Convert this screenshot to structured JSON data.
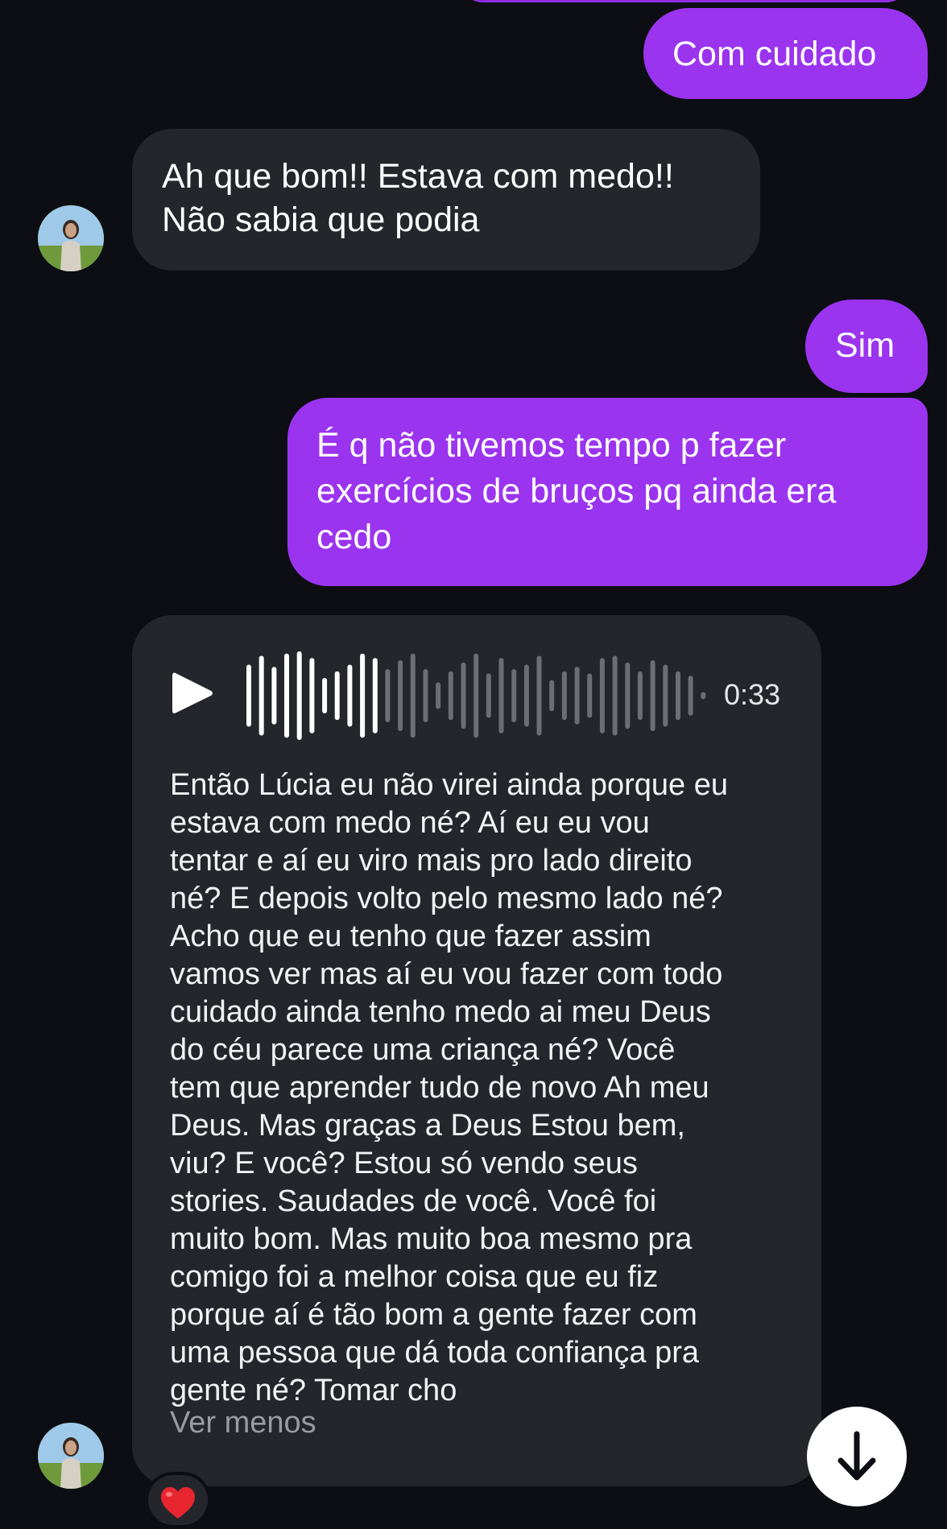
{
  "messages": {
    "out_1": "Com cuidado",
    "in_1_line1": "Ah que bom!! Estava com medo!!",
    "in_1_line2": "Não sabia que podia",
    "out_2": "Sim",
    "out_3_line1": "É q não tivemos tempo p fazer",
    "out_3_line2": "exercícios de bruços pq ainda era",
    "out_3_line3": "cedo"
  },
  "voice_message": {
    "duration": "0:33",
    "played_fraction": 0.2,
    "transcript_lines": [
      "Então Lúcia eu não virei ainda porque eu",
      "estava com medo né? Aí eu eu vou",
      "tentar e aí eu viro mais pro lado direito",
      "né? E depois volto pelo mesmo lado né?",
      "Acho que eu tenho que fazer assim",
      "vamos ver mas aí eu vou fazer com todo",
      "cuidado ainda tenho medo ai meu Deus",
      "do céu parece uma criança né? Você",
      "tem que aprender tudo de novo Ah meu",
      "Deus. Mas graças a Deus Estou bem,",
      "viu? E você? Estou só vendo seus",
      "stories. Saudades de você. Você foi",
      "muito bom. Mas muito boa mesmo pra",
      "comigo foi a melhor coisa que eu fiz",
      "porque aí é tão bom a gente fazer com",
      "uma pessoa que dá toda confiança pra",
      "gente né? Tomar cho"
    ],
    "see_less": "Ver menos"
  },
  "reaction": "❤️",
  "icons": {
    "play": "play-icon",
    "scroll": "arrow-down-icon"
  },
  "colors": {
    "background": "#0c0e13",
    "outgoing_bubble": "#9b34ef",
    "incoming_bubble": "#24262c",
    "waveform_played": "#ffffff",
    "waveform_unplayed": "#6c6e74"
  }
}
